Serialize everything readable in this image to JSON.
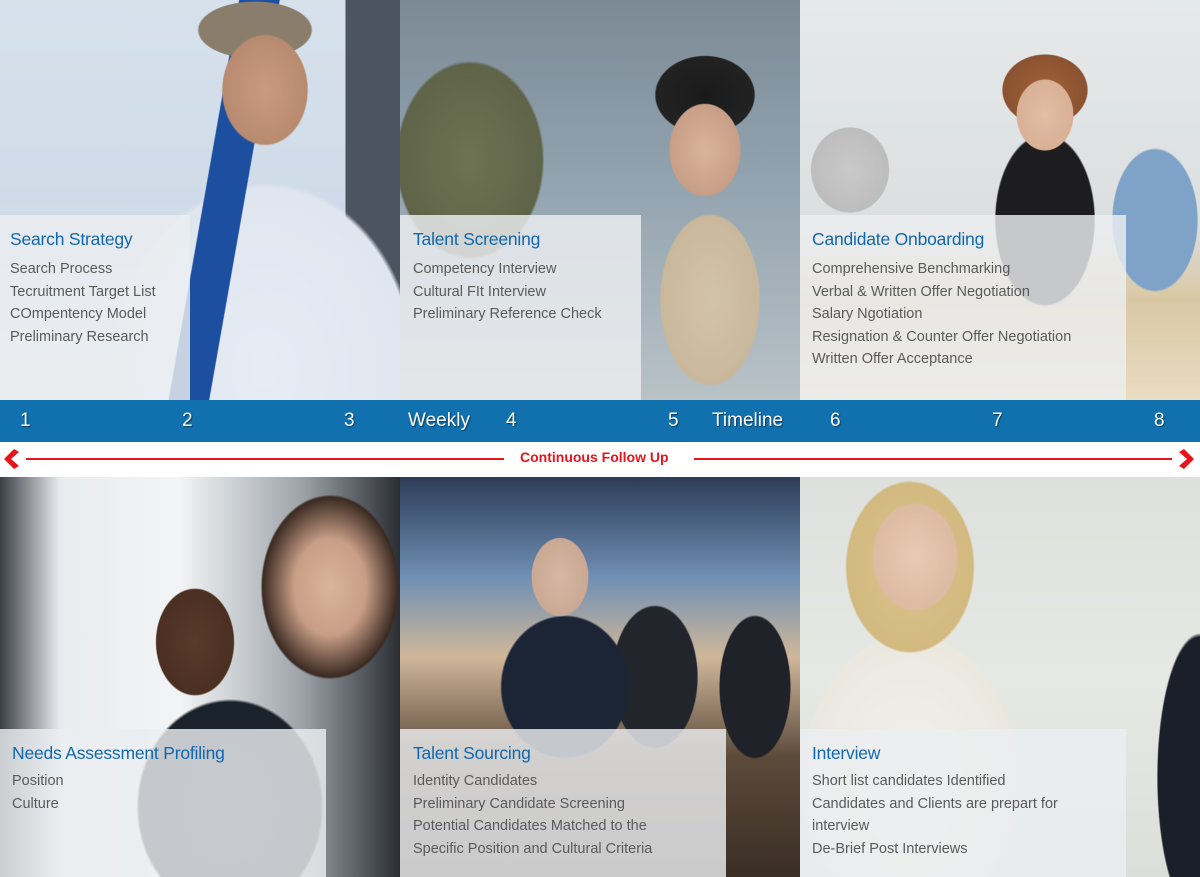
{
  "colors": {
    "timeline_bar": "#1170ae",
    "panel_title": "#1167b0",
    "panel_text": "#5a5a5a",
    "follow_up": "#e8141b"
  },
  "top_row": [
    {
      "title": "Search Strategy",
      "items": [
        "Search Process",
        "Tecruitment Target List",
        "COmpentency Model",
        "Preliminary Research"
      ]
    },
    {
      "title": "Talent Screening",
      "items": [
        "Competency Interview",
        "Cultural FIt Interview",
        "Preliminary Reference Check"
      ]
    },
    {
      "title": "Candidate Onboarding",
      "items": [
        "Comprehensive Benchmarking",
        "Verbal & Written Offer Negotiation",
        "Salary Ngotiation",
        "Resignation & Counter Offer Negotiation",
        "Written Offer Acceptance"
      ]
    }
  ],
  "timeline": {
    "numbers": [
      "1",
      "2",
      "3",
      "4",
      "5",
      "6",
      "7",
      "8"
    ],
    "weekly_label": "Weekly",
    "timeline_label": "Timeline"
  },
  "follow_up": {
    "label": "Continuous Follow Up",
    "left_icon": "chevron-left-icon",
    "right_icon": "chevron-right-icon"
  },
  "bottom_row": [
    {
      "title": "Needs Assessment Profiling",
      "items": [
        "Position",
        "Culture"
      ]
    },
    {
      "title": "Talent Sourcing",
      "items": [
        "Identity Candidates",
        "Preliminary Candidate Screening",
        "Potential Candidates Matched to the",
        "Specific Position and Cultural Criteria"
      ]
    },
    {
      "title": "Interview",
      "items": [
        "Short list candidates Identified",
        "Candidates and Clients are prepart for",
        "interview",
        "De-Brief Post Interviews"
      ]
    }
  ]
}
